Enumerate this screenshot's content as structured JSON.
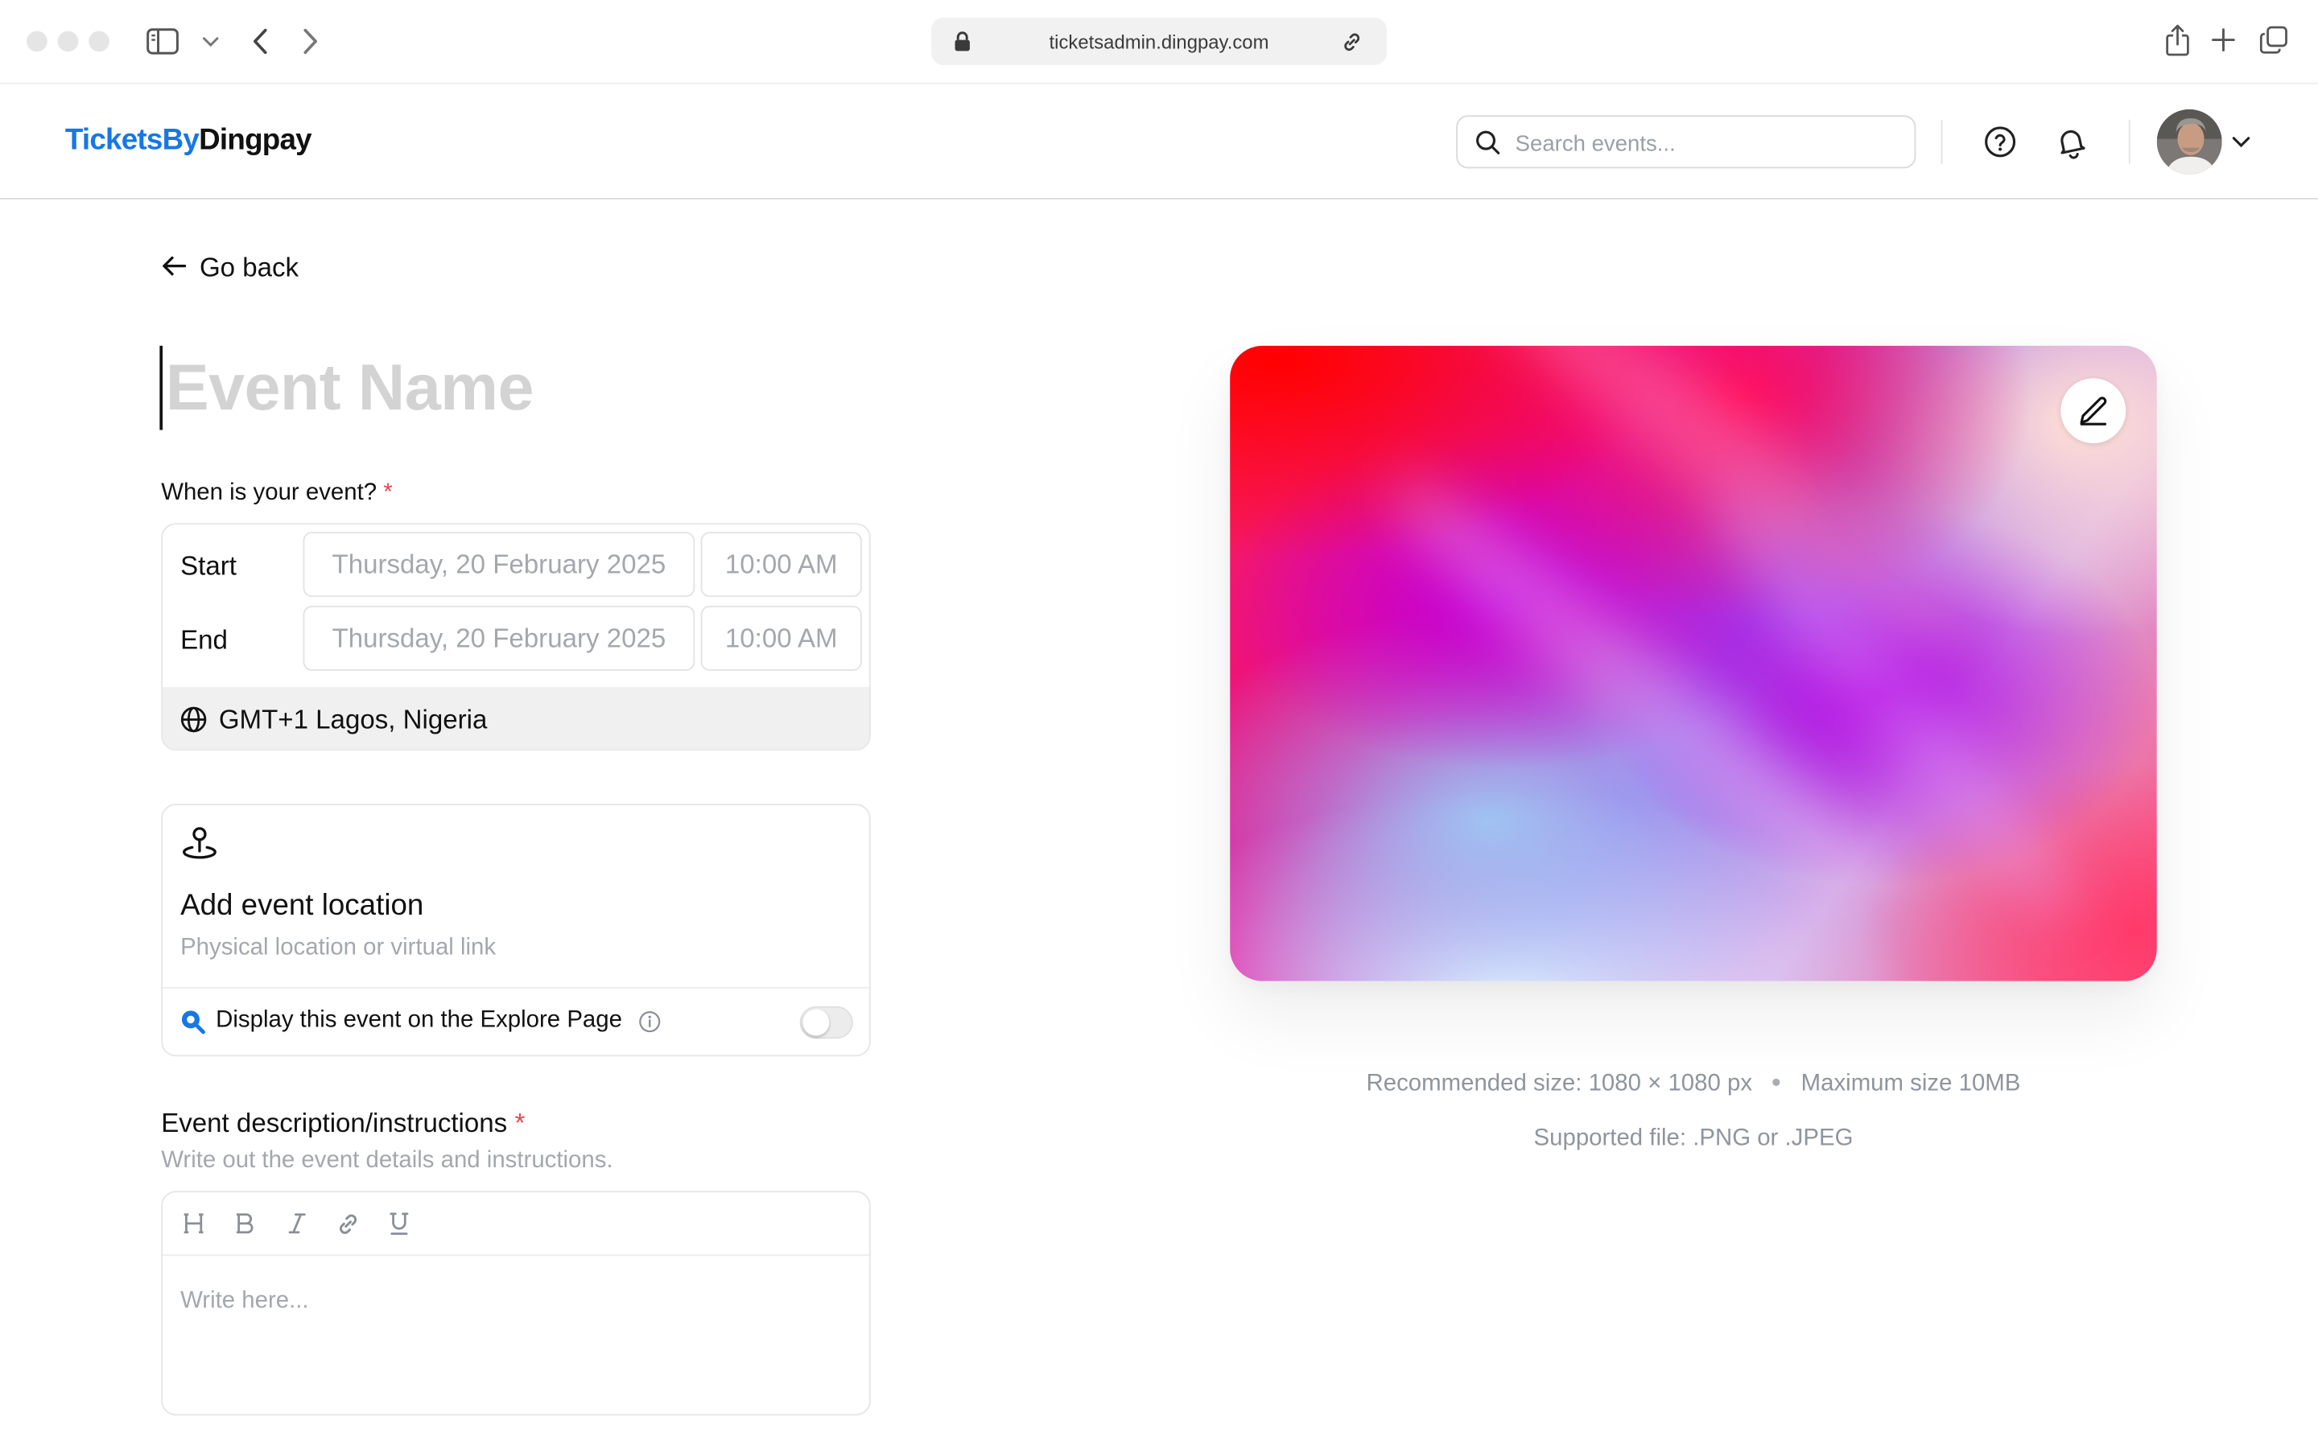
{
  "browser": {
    "url": "ticketsadmin.dingpay.com"
  },
  "header": {
    "logo_part1": "TicketsBy",
    "logo_part2": "Dingpay",
    "search_placeholder": "Search events..."
  },
  "nav": {
    "go_back_label": "Go back"
  },
  "event": {
    "name_placeholder": "Event Name",
    "when_label": "When is your event?",
    "required_mark": "*",
    "start_label": "Start",
    "end_label": "End",
    "start_date": "Thursday, 20 February 2025",
    "start_time": "10:00 AM",
    "end_date": "Thursday, 20 February 2025",
    "end_time": "10:00 AM",
    "timezone": "GMT+1 Lagos, Nigeria"
  },
  "location": {
    "title": "Add event location",
    "subtitle": "Physical location or virtual link",
    "explore_label": "Display this event on the Explore Page",
    "explore_enabled": false
  },
  "description": {
    "title": "Event description/instructions",
    "required_mark": "*",
    "subtitle": "Write out the event details and instructions.",
    "toolbar": [
      "H",
      "B",
      "I",
      "link",
      "U"
    ],
    "placeholder": "Write here..."
  },
  "cover": {
    "recommended": "Recommended size: 1080 × 1080 px",
    "maximum": "Maximum size 10MB",
    "supported": "Supported file: .PNG or .JPEG"
  },
  "colors": {
    "brand_blue": "#1677e6",
    "required_red": "#e5484d",
    "muted_text": "#a4a8ad"
  }
}
